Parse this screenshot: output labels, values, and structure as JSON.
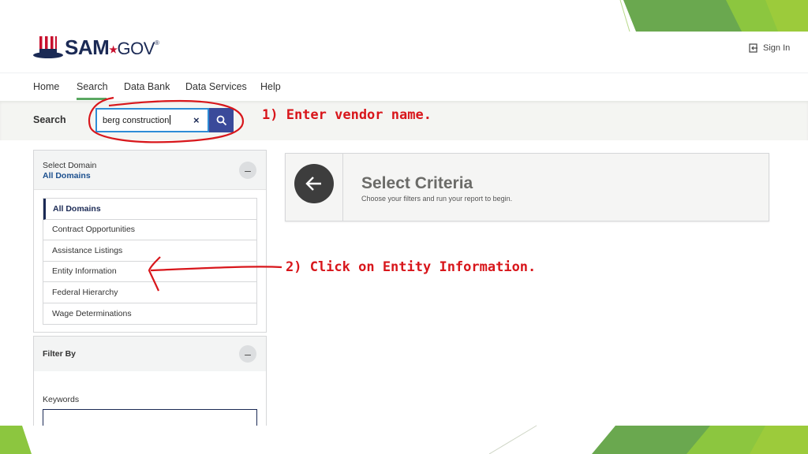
{
  "header": {
    "logo_text": "SAM",
    "logo_gov": "GOV",
    "logo_star": "★",
    "logo_reg": "®",
    "signin_label": "Sign In"
  },
  "nav": {
    "items": [
      "Home",
      "Search",
      "Data Bank",
      "Data Services",
      "Help"
    ],
    "active": "Search"
  },
  "search": {
    "label": "Search",
    "value": "berg construction",
    "clear_glyph": "×"
  },
  "annotations": {
    "step1": "1) Enter vendor name.",
    "step2": "2) Click on Entity Information."
  },
  "domain_panel": {
    "title": "Select Domain",
    "selected": "All Domains",
    "collapse_glyph": "–",
    "items": [
      "All Domains",
      "Contract Opportunities",
      "Assistance Listings",
      "Entity Information",
      "Federal Hierarchy",
      "Wage Determinations"
    ]
  },
  "filter_panel": {
    "title": "Filter By",
    "collapse_glyph": "–",
    "keywords_label": "Keywords",
    "keywords_value": ""
  },
  "criteria": {
    "title": "Select Criteria",
    "subtitle": "Choose your filters and run your report to begin."
  },
  "colors": {
    "annotation_red": "#d8161b",
    "brand_navy": "#1b2a55",
    "search_button": "#3a4a9a",
    "nav_active_underline": "#5aa862",
    "deco_green_dark": "#6aa84f",
    "deco_green_light": "#9ccb3b"
  },
  "icons": {
    "signin": "sign-in-icon",
    "search": "magnifier-icon",
    "back": "arrow-left-icon",
    "logo": "uncle-sam-hat-icon"
  }
}
